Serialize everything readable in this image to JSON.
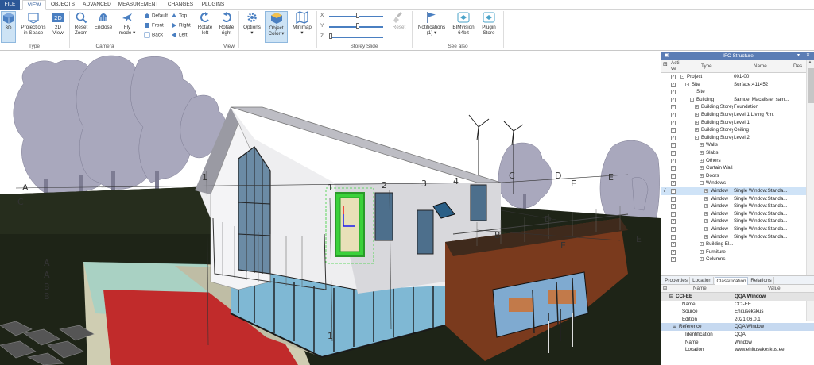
{
  "menu": {
    "tabs": [
      {
        "label": "FILE",
        "file": true
      },
      {
        "label": "VIEW",
        "active": true
      },
      {
        "label": "OBJECTS"
      },
      {
        "label": "ADVANCED"
      },
      {
        "label": "MEASUREMENT"
      },
      {
        "label": "CHANGES"
      },
      {
        "label": "PLUGINS"
      }
    ]
  },
  "ribbon": {
    "type_group": {
      "label": "Type",
      "btn_3d": "3D",
      "btn_projections_1": "Projections",
      "btn_projections_2": "in Space",
      "btn_2d_1": "2D",
      "btn_2d_2": "View"
    },
    "camera_group": {
      "label": "Camera",
      "reset_1": "Reset",
      "reset_2": "Zoom",
      "enclose": "Enclose",
      "fly_1": "Fly",
      "fly_2": "mode"
    },
    "view_group": {
      "label": "View",
      "default": "Default",
      "front": "Front",
      "back": "Back",
      "top": "Top",
      "right": "Right",
      "left": "Left",
      "rot_left_1": "Rotate",
      "rot_left_2": "left",
      "rot_right_1": "Rotate",
      "rot_right_2": "right",
      "options": "Options",
      "object_color_1": "Object",
      "object_color_2": "Color",
      "minimap": "Minimap"
    },
    "storey_group": {
      "label": "Storey Slide",
      "x": "X",
      "y": "Y",
      "z": "Z",
      "reset": "Reset"
    },
    "see_also_group": {
      "label": "See also",
      "notifications_1": "Notifications",
      "notifications_2": "(1)",
      "bimvision_1": "BIMvision",
      "bimvision_2": "64bit",
      "plugin_1": "Plugin",
      "plugin_2": "Store"
    }
  },
  "viewport": {
    "labels": {
      "a1": "A",
      "c1": "C",
      "a2": "A",
      "a3": "A",
      "b1": "B",
      "b2": "B",
      "n1": "1",
      "n2": "2",
      "n3": "3",
      "n4": "4",
      "n5": "1",
      "n6": "1",
      "c2": "C",
      "d1": "D",
      "e1": "E",
      "e2": "E",
      "d2": "D",
      "e3": "E",
      "b3": "B",
      "e4": "E"
    }
  },
  "ifc_panel": {
    "title": "IFC Structure",
    "columns": {
      "active_1": "Acti",
      "active_2": "ve",
      "type": "Type",
      "name": "Name",
      "desc": "Des"
    },
    "rows": [
      {
        "type": "Project",
        "name": "001-00",
        "indent": 0,
        "exp": "-"
      },
      {
        "type": "Site",
        "name": "Surface:411452",
        "indent": 1,
        "exp": "-"
      },
      {
        "type": "Site",
        "name": "",
        "indent": 2,
        "exp": ""
      },
      {
        "type": "Building",
        "name": "Samuel Macalister sam...",
        "indent": 2,
        "exp": "-"
      },
      {
        "type": "Building Storey",
        "name": "Foundation",
        "indent": 3,
        "exp": "+"
      },
      {
        "type": "Building Storey",
        "name": "Level 1 Living Rm.",
        "indent": 3,
        "exp": "+"
      },
      {
        "type": "Building Storey",
        "name": "Level 1",
        "indent": 3,
        "exp": "+"
      },
      {
        "type": "Building Storey",
        "name": "Ceiling",
        "indent": 3,
        "exp": "+"
      },
      {
        "type": "Building Storey",
        "name": "Level 2",
        "indent": 3,
        "exp": "-"
      },
      {
        "type": "Walls",
        "name": "",
        "indent": 4,
        "exp": "+"
      },
      {
        "type": "Slabs",
        "name": "",
        "indent": 4,
        "exp": "+"
      },
      {
        "type": "Others",
        "name": "",
        "indent": 4,
        "exp": "+"
      },
      {
        "type": "Curtain Walls",
        "name": "",
        "indent": 4,
        "exp": "+"
      },
      {
        "type": "Doors",
        "name": "",
        "indent": 4,
        "exp": "+"
      },
      {
        "type": "Windows",
        "name": "",
        "indent": 4,
        "exp": "-"
      },
      {
        "type": "Window",
        "name": "Single Window:Standa...",
        "indent": 5,
        "exp": "+",
        "hl": true,
        "mark": "√"
      },
      {
        "type": "Window",
        "name": "Single Window:Standa...",
        "indent": 5,
        "exp": "+"
      },
      {
        "type": "Window",
        "name": "Single Window:Standa...",
        "indent": 5,
        "exp": "+"
      },
      {
        "type": "Window",
        "name": "Single Window:Standa...",
        "indent": 5,
        "exp": "+"
      },
      {
        "type": "Window",
        "name": "Single Window:Standa...",
        "indent": 5,
        "exp": "+"
      },
      {
        "type": "Window",
        "name": "Single Window:Standa...",
        "indent": 5,
        "exp": "+"
      },
      {
        "type": "Window",
        "name": "Single Window:Standa...",
        "indent": 5,
        "exp": "+"
      },
      {
        "type": "Building El...",
        "name": "",
        "indent": 4,
        "exp": "+"
      },
      {
        "type": "Furniture",
        "name": "",
        "indent": 4,
        "exp": "+"
      },
      {
        "type": "Columns",
        "name": "",
        "indent": 4,
        "exp": "+"
      }
    ]
  },
  "props_panel": {
    "tabs": [
      "Properties",
      "Location",
      "Classification",
      "Relations"
    ],
    "active_tab": "Classification",
    "columns": {
      "name": "Name",
      "value": "Value"
    },
    "rows": [
      {
        "k": "CCI-EE",
        "v": "QQA Window",
        "kind": "group"
      },
      {
        "k": "Name",
        "v": "CCI-EE",
        "kind": "item"
      },
      {
        "k": "Source",
        "v": "Ehitusekskus",
        "kind": "item"
      },
      {
        "k": "Edition",
        "v": "2021.06.0.1",
        "kind": "item"
      },
      {
        "k": "Reference",
        "v": "QQA Window",
        "kind": "ref"
      },
      {
        "k": "Identification",
        "v": "QQA",
        "kind": "sub"
      },
      {
        "k": "Name",
        "v": "Window",
        "kind": "sub"
      },
      {
        "k": "Location",
        "v": "www.ehitusekeskus.ee",
        "kind": "sub"
      }
    ]
  },
  "colors": {
    "accent": "#2b5797",
    "panel_header": "#5b7db5",
    "selected_green": "#3bd13b",
    "sky": "#ffffff",
    "ground": "#1e2417"
  }
}
